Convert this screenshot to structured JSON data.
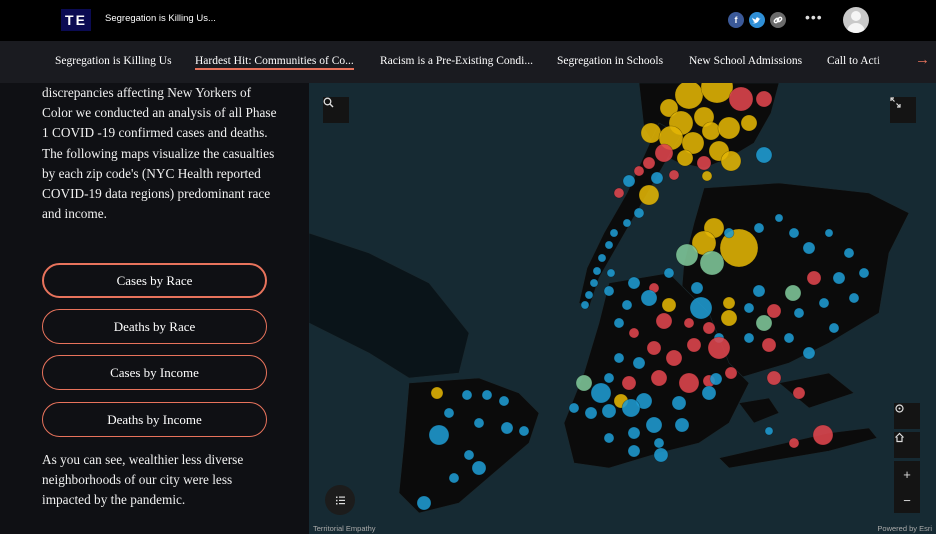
{
  "header": {
    "logo": "TE",
    "title": "Segregation is Killing Us..."
  },
  "nav": {
    "tabs": [
      {
        "label": "Segregation is Killing Us"
      },
      {
        "label": "Hardest Hit: Communities of Co..."
      },
      {
        "label": "Racism is a Pre-Existing Condi..."
      },
      {
        "label": "Segregation in Schools"
      },
      {
        "label": "New School Admissions"
      },
      {
        "label": "Call to Acti"
      }
    ],
    "next_icon": "arrow-right-icon"
  },
  "panel": {
    "intro": "discrepancies affecting New Yorkers of Color we conducted an analysis of all Phase 1 COVID -19 confirmed cases and deaths. The following maps visualize the casualties by each zip code's (NYC Health reported COVID-19 data regions) predominant race and income.",
    "buttons": [
      {
        "label": "Cases by Race",
        "selected": true
      },
      {
        "label": "Deaths by Race"
      },
      {
        "label": "Cases by Income"
      },
      {
        "label": "Deaths by Income"
      }
    ],
    "outro": "As you can see, wealthier less diverse neighborhoods of our city were less impacted by the pandemic."
  },
  "map": {
    "attribution_left": "Territorial Empathy",
    "attribution_right": "Powered by Esri",
    "colors": {
      "yellow": "#e3b505",
      "blue": "#1f9bd1",
      "red": "#e0454d",
      "green": "#7fc79a",
      "land": "#0b0b0b",
      "water": "#162a33"
    }
  }
}
